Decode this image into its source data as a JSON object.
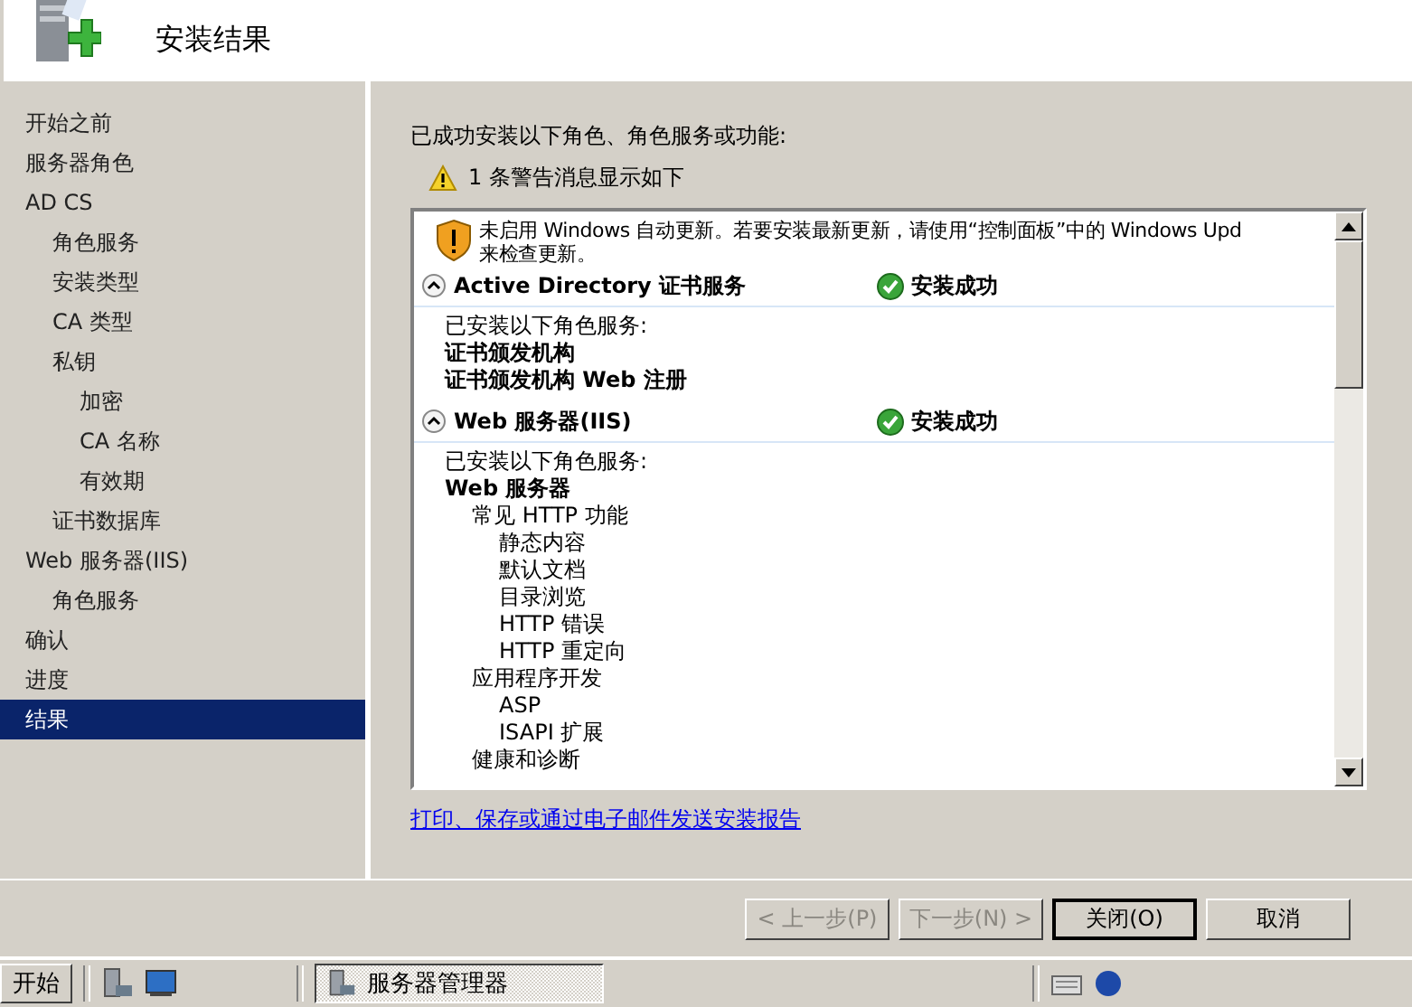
{
  "header": {
    "title": "安装结果"
  },
  "sidebar": {
    "items": [
      {
        "label": "开始之前",
        "selected": false
      },
      {
        "label": "服务器角色",
        "selected": false
      },
      {
        "label": "AD CS",
        "selected": false,
        "children": [
          {
            "label": "角色服务",
            "selected": false
          },
          {
            "label": "安装类型",
            "selected": false
          },
          {
            "label": "CA 类型",
            "selected": false
          },
          {
            "label": "私钥",
            "selected": false,
            "children": [
              {
                "label": "加密",
                "selected": false
              },
              {
                "label": "CA 名称",
                "selected": false
              },
              {
                "label": "有效期",
                "selected": false
              }
            ]
          },
          {
            "label": "证书数据库",
            "selected": false
          }
        ]
      },
      {
        "label": "Web 服务器(IIS)",
        "selected": false,
        "children": [
          {
            "label": "角色服务",
            "selected": false
          }
        ]
      },
      {
        "label": "确认",
        "selected": false
      },
      {
        "label": "进度",
        "selected": false
      },
      {
        "label": "结果",
        "selected": true
      }
    ]
  },
  "content": {
    "intro": "已成功安装以下角色、角色服务或功能:",
    "warning_summary": "1 条警告消息显示如下",
    "warning": "未启用 Windows 自动更新。若要安装最新更新，请使用“控制面板”中的 Windows Upd",
    "warning_line2": "来检查更新。",
    "sections": [
      {
        "title": "Active Directory 证书服务",
        "status": "安装成功",
        "expanded": true,
        "caption": "已安装以下角色服务:",
        "services": [
          {
            "label": "证书颁发机构"
          },
          {
            "label": "证书颁发机构 Web 注册"
          }
        ]
      },
      {
        "title": "Web 服务器(IIS)",
        "status": "安装成功",
        "expanded": true,
        "caption": "已安装以下角色服务:",
        "services": [
          {
            "label": "Web 服务器",
            "children": [
              {
                "label": "常见 HTTP 功能",
                "children": [
                  {
                    "label": "静态内容"
                  },
                  {
                    "label": "默认文档"
                  },
                  {
                    "label": "目录浏览"
                  },
                  {
                    "label": "HTTP 错误"
                  },
                  {
                    "label": "HTTP 重定向"
                  }
                ]
              },
              {
                "label": "应用程序开发",
                "children": [
                  {
                    "label": "ASP"
                  },
                  {
                    "label": "ISAPI 扩展"
                  }
                ]
              },
              {
                "label": "健康和诊断"
              }
            ]
          }
        ]
      }
    ],
    "report_link": "打印、保存或通过电子邮件发送安装报告"
  },
  "buttons": [
    {
      "label": "< 上一步(P)",
      "disabled": true,
      "default": false
    },
    {
      "label": "下一步(N) >",
      "disabled": true,
      "default": false
    },
    {
      "label": "关闭(O)",
      "disabled": false,
      "default": true
    },
    {
      "label": "取消",
      "disabled": false,
      "default": false
    }
  ],
  "taskbar": {
    "start": "开始",
    "tasks": [
      {
        "label": "服务器管理器",
        "selected": true
      }
    ]
  }
}
